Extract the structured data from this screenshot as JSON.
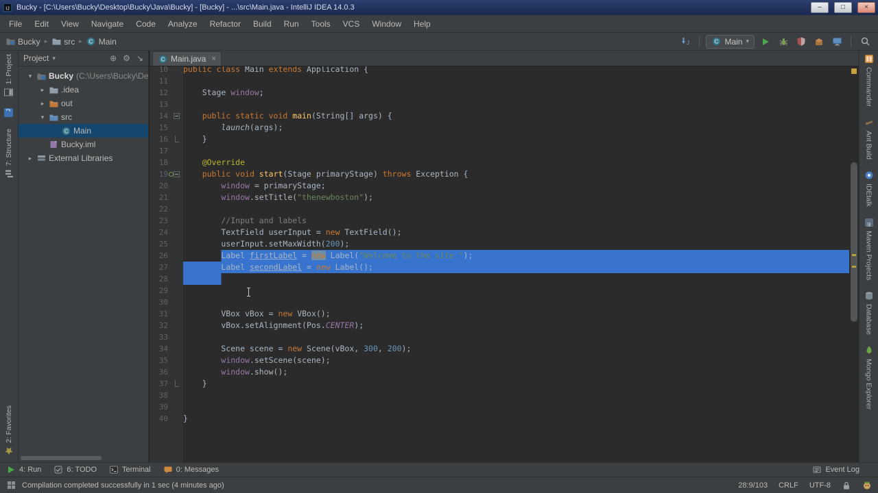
{
  "colors": {
    "selection": "#3874cd",
    "tree_selection": "#15466e",
    "titlebar_top": "#2c3f6e",
    "titlebar_bottom": "#1a294f",
    "accent_green": "#4ca64c"
  },
  "window": {
    "title": "Bucky - [C:\\Users\\Bucky\\Desktop\\Bucky\\Java\\Bucky] - [Bucky] - ...\\src\\Main.java - IntelliJ IDEA 14.0.3",
    "controls": {
      "minimize": "–",
      "maximize": "□",
      "close": "×"
    }
  },
  "menus": [
    "File",
    "Edit",
    "View",
    "Navigate",
    "Code",
    "Analyze",
    "Refactor",
    "Build",
    "Run",
    "Tools",
    "VCS",
    "Window",
    "Help"
  ],
  "navbar": {
    "crumbs": [
      {
        "label": "Bucky",
        "icon": "project"
      },
      {
        "label": "src",
        "icon": "folder"
      },
      {
        "label": "Main",
        "icon": "class"
      }
    ],
    "left_buttons": [
      "update-project"
    ],
    "run_config": "Main",
    "run_buttons": [
      "run",
      "debug",
      "coverage",
      "package",
      "monitor"
    ],
    "search_icon": "search"
  },
  "left_stripe": {
    "top": [
      {
        "label": "1: Project",
        "icon": "project-stripe"
      },
      {
        "label": "",
        "icon": "jtool"
      },
      {
        "label": "7: Structure",
        "icon": "structure"
      }
    ],
    "bottom": [
      {
        "label": "2: Favorites",
        "icon": "favorites"
      }
    ]
  },
  "right_stripe": [
    {
      "label": "Commander",
      "icon": "commander"
    },
    {
      "label": "Ant Build",
      "icon": "ant"
    },
    {
      "label": "IDEtalk",
      "icon": "idetalk"
    },
    {
      "label": "Maven Projects",
      "icon": "maven"
    },
    {
      "label": "Database",
      "icon": "database"
    },
    {
      "label": "Mongo Explorer",
      "icon": "mongo"
    }
  ],
  "project_panel": {
    "title": "Project",
    "tree": [
      {
        "label": "Bucky",
        "extra": "(C:\\Users\\Bucky\\Desk",
        "icon": "project",
        "indent": 0,
        "arrow": "down",
        "bold": true
      },
      {
        "label": ".idea",
        "icon": "folder",
        "indent": 1,
        "arrow": "right"
      },
      {
        "label": "out",
        "icon": "folder-out",
        "indent": 1,
        "arrow": "right"
      },
      {
        "label": "src",
        "icon": "folder-src",
        "indent": 1,
        "arrow": "down"
      },
      {
        "label": "Main",
        "icon": "class",
        "indent": 2,
        "selected": true
      },
      {
        "label": "Bucky.iml",
        "icon": "iml",
        "indent": 1
      },
      {
        "label": "External Libraries",
        "icon": "lib",
        "indent": 0,
        "arrow": "right"
      }
    ]
  },
  "tabs": [
    {
      "label": "Main.java",
      "icon": "class",
      "close": "×"
    }
  ],
  "editor": {
    "lines": [
      {
        "n": 10,
        "parts": [
          [
            "kw",
            "public class "
          ],
          [
            "id",
            "Main "
          ],
          [
            "kw",
            "extends "
          ],
          [
            "id",
            "Application {"
          ]
        ]
      },
      {
        "n": 11
      },
      {
        "n": 12,
        "parts": [
          [
            "id",
            "    Stage "
          ],
          [
            "fld",
            "window"
          ],
          [
            "id",
            ";"
          ]
        ]
      },
      {
        "n": 13
      },
      {
        "n": 14,
        "fold": "start",
        "parts": [
          [
            "id",
            "    "
          ],
          [
            "kw",
            "public static void "
          ],
          [
            "mth",
            "main"
          ],
          [
            "id",
            "(String[] args) {"
          ]
        ]
      },
      {
        "n": 15,
        "parts": [
          [
            "id",
            "        "
          ],
          [
            "itl",
            "launch"
          ],
          [
            "id",
            "(args);"
          ]
        ]
      },
      {
        "n": 16,
        "fold": "end",
        "parts": [
          [
            "id",
            "    }"
          ]
        ]
      },
      {
        "n": 17
      },
      {
        "n": 18,
        "parts": [
          [
            "id",
            "    "
          ],
          [
            "ann",
            "@Override"
          ]
        ]
      },
      {
        "n": 19,
        "fold": "start",
        "marker": "override",
        "parts": [
          [
            "id",
            "    "
          ],
          [
            "kw",
            "public void "
          ],
          [
            "mth",
            "start"
          ],
          [
            "id",
            "(Stage primaryStage) "
          ],
          [
            "kw",
            "throws "
          ],
          [
            "id",
            "Exception {"
          ]
        ]
      },
      {
        "n": 20,
        "parts": [
          [
            "id",
            "        "
          ],
          [
            "fld",
            "window"
          ],
          [
            "id",
            " = primaryStage;"
          ]
        ]
      },
      {
        "n": 21,
        "parts": [
          [
            "id",
            "        "
          ],
          [
            "fld",
            "window"
          ],
          [
            "id",
            ".setTitle("
          ],
          [
            "str",
            "\"thenewboston\""
          ],
          [
            "id",
            ");"
          ]
        ]
      },
      {
        "n": 22
      },
      {
        "n": 23,
        "parts": [
          [
            "cmt",
            "        //Input and labels"
          ]
        ]
      },
      {
        "n": 24,
        "parts": [
          [
            "id",
            "        TextField userInput = "
          ],
          [
            "kw",
            "new"
          ],
          [
            "id",
            " TextField();"
          ]
        ]
      },
      {
        "n": 25,
        "parts": [
          [
            "id",
            "        userInput.setMaxWidth("
          ],
          [
            "num",
            "200"
          ],
          [
            "id",
            ");"
          ]
        ]
      },
      {
        "n": 26,
        "sel": "start",
        "parts": [
          [
            "id",
            "        Label "
          ],
          [
            "und",
            "firstLabel"
          ],
          [
            "id",
            " = "
          ],
          [
            "kwhl",
            "new"
          ],
          [
            "id",
            " Label("
          ],
          [
            "str",
            "\"Welcome to the site \""
          ],
          [
            "id",
            ");"
          ]
        ]
      },
      {
        "n": 27,
        "sel": "mid",
        "parts": [
          [
            "id",
            "        Label "
          ],
          [
            "und",
            "secondLabel"
          ],
          [
            "id",
            " = "
          ],
          [
            "kw",
            "new"
          ],
          [
            "id",
            " Label();"
          ]
        ]
      },
      {
        "n": 28,
        "sel": "end"
      },
      {
        "n": 29
      },
      {
        "n": 30
      },
      {
        "n": 31,
        "parts": [
          [
            "id",
            "        VBox vBox = "
          ],
          [
            "kw",
            "new"
          ],
          [
            "id",
            " VBox();"
          ]
        ]
      },
      {
        "n": 32,
        "parts": [
          [
            "id",
            "        vBox.setAlignment(Pos."
          ],
          [
            "cnst",
            "CENTER"
          ],
          [
            "id",
            ");"
          ]
        ]
      },
      {
        "n": 33
      },
      {
        "n": 34,
        "parts": [
          [
            "id",
            "        Scene scene = "
          ],
          [
            "kw",
            "new"
          ],
          [
            "id",
            " Scene(vBox, "
          ],
          [
            "num",
            "300"
          ],
          [
            "id",
            ", "
          ],
          [
            "num",
            "200"
          ],
          [
            "id",
            ");"
          ]
        ]
      },
      {
        "n": 35,
        "parts": [
          [
            "id",
            "        "
          ],
          [
            "fld",
            "window"
          ],
          [
            "id",
            ".setScene(scene);"
          ]
        ]
      },
      {
        "n": 36,
        "parts": [
          [
            "id",
            "        "
          ],
          [
            "fld",
            "window"
          ],
          [
            "id",
            ".show();"
          ]
        ]
      },
      {
        "n": 37,
        "fold": "end",
        "parts": [
          [
            "id",
            "    }"
          ]
        ]
      },
      {
        "n": 38
      },
      {
        "n": 39
      },
      {
        "n": 40,
        "parts": [
          [
            "id",
            "}"
          ]
        ]
      }
    ]
  },
  "bottom_bar": {
    "items": [
      {
        "label": "4: Run",
        "icon": "run"
      },
      {
        "label": "6: TODO",
        "icon": "todo"
      },
      {
        "label": "Terminal",
        "icon": "terminal"
      },
      {
        "label": "0: Messages",
        "icon": "messages"
      }
    ],
    "right": {
      "label": "Event Log",
      "icon": "eventlog"
    }
  },
  "status_bar": {
    "message": "Compilation completed successfully in 1 sec (4 minutes ago)",
    "position": "28:9/103",
    "line_separator": "CRLF",
    "encoding": "UTF-8"
  }
}
